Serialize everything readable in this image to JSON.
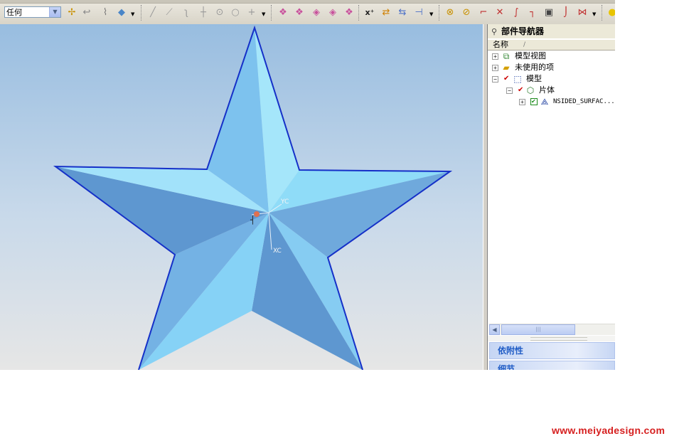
{
  "toolbar": {
    "filter_value": "任何",
    "icons": [
      "snap-point-icon",
      "undo-curve-icon",
      "measure-icon",
      "render-cube-icon",
      "line-icon",
      "line-angle-icon",
      "arc-icon",
      "point-icon",
      "circle-point-icon",
      "circle-icon",
      "plus-icon",
      "surface-1-icon",
      "surface-2-icon",
      "surface-3-icon",
      "surface-4-icon",
      "surface-5-icon",
      "xyz-icon",
      "transform-icon",
      "transform-2-icon",
      "mirror-icon",
      "analysis-1-icon",
      "analysis-2-icon",
      "trim-icon",
      "split-icon",
      "bridge-icon",
      "corner-icon",
      "offset-icon",
      "fillet-icon",
      "blend-icon",
      "lamp-icon"
    ]
  },
  "viewport": {
    "axis_labels": {
      "y": "YC",
      "x": "XC"
    }
  },
  "navigator": {
    "title": "部件导航器",
    "column_header": "名称",
    "column_marker": "/",
    "tree": [
      {
        "label": "模型视图",
        "expander": "+",
        "checked": false,
        "icon": "model-views-icon"
      },
      {
        "label": "未使用的项",
        "expander": "+",
        "checked": false,
        "icon": "folder-icon"
      },
      {
        "label": "模型",
        "expander": "−",
        "checked": true,
        "icon": "model-icon"
      },
      {
        "label": "片体",
        "expander": "−",
        "checked": true,
        "icon": "sheet-body-icon"
      },
      {
        "label": "NSIDED_SURFAC...",
        "expander": "+",
        "checked": true,
        "icon": "surface-feature-icon"
      }
    ],
    "sections": {
      "dependencies": "依附性",
      "details": "细节"
    }
  },
  "watermark": "www.meiyadesign.com",
  "colors": {
    "star_light": "#8fdcf8",
    "star_mid": "#79b9e6",
    "star_dark": "#5e97d0",
    "star_outline": "#1530c8",
    "section_text": "#215dc6",
    "watermark": "#d62020"
  }
}
